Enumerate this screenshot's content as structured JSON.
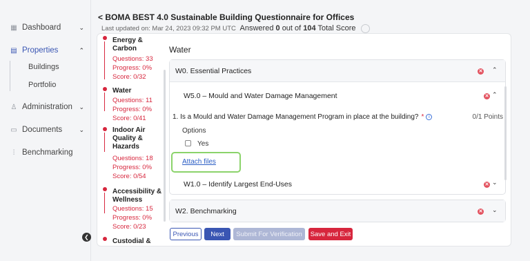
{
  "sidebar": {
    "items": [
      {
        "label": "Dashboard",
        "icon": "grid-icon"
      },
      {
        "label": "Properties",
        "icon": "building-icon"
      },
      {
        "label": "Administration",
        "icon": "users-icon"
      },
      {
        "label": "Documents",
        "icon": "folder-icon"
      },
      {
        "label": "Benchmarking",
        "icon": "bar-chart-icon"
      }
    ],
    "sub_items": [
      "Buildings",
      "Portfolio"
    ]
  },
  "header": {
    "back_icon": "chevron-left-icon",
    "title": "BOMA BEST 4.0 Sustainable Building Questionnaire for Offices",
    "last_updated": "Last updated on: Mar 24, 2023 09:32 PM UTC",
    "answered_prefix": "Answered",
    "answered_count": "0",
    "answered_mid": "out of",
    "answered_total": "104",
    "total_score_label": "Total Score"
  },
  "categories": [
    {
      "name": "Energy & Carbon",
      "questions": "Questions: 33",
      "progress": "Progress: 0%",
      "score": "Score: 0/32"
    },
    {
      "name": "Water",
      "questions": "Questions: 11",
      "progress": "Progress: 0%",
      "score": "Score: 0/41"
    },
    {
      "name": "Indoor Air Quality & Hazards",
      "questions": "Questions: 18",
      "progress": "Progress: 0%",
      "score": "Score: 0/54"
    },
    {
      "name": "Accessibility & Wellness",
      "questions": "Questions: 15",
      "progress": "Progress: 0%",
      "score": "Score: 0/23"
    },
    {
      "name": "Custodial &",
      "questions": "",
      "progress": "",
      "score": ""
    }
  ],
  "panel": {
    "title": "Water",
    "section_w0": "W0. Essential Practices",
    "sub_w5": "W5.0 – Mould and Water Damage Management",
    "question": "1. Is a Mould and Water Damage Management Program in place at the building?",
    "required_mark": "*",
    "info_glyph": "i",
    "points": "0/1 Points",
    "options_label": "Options",
    "option_yes": "Yes",
    "attach_files": "Attach files",
    "sub_w1": "W1.0 – Identify Largest End-Uses",
    "section_w2": "W2. Benchmarking"
  },
  "buttons": {
    "previous": "Previous",
    "next": "Next",
    "submit": "Submit For Verification",
    "save_exit": "Save and Exit"
  },
  "colors": {
    "accent": "#3a56b3",
    "danger": "#d7263d",
    "highlight": "#8bd36a"
  }
}
